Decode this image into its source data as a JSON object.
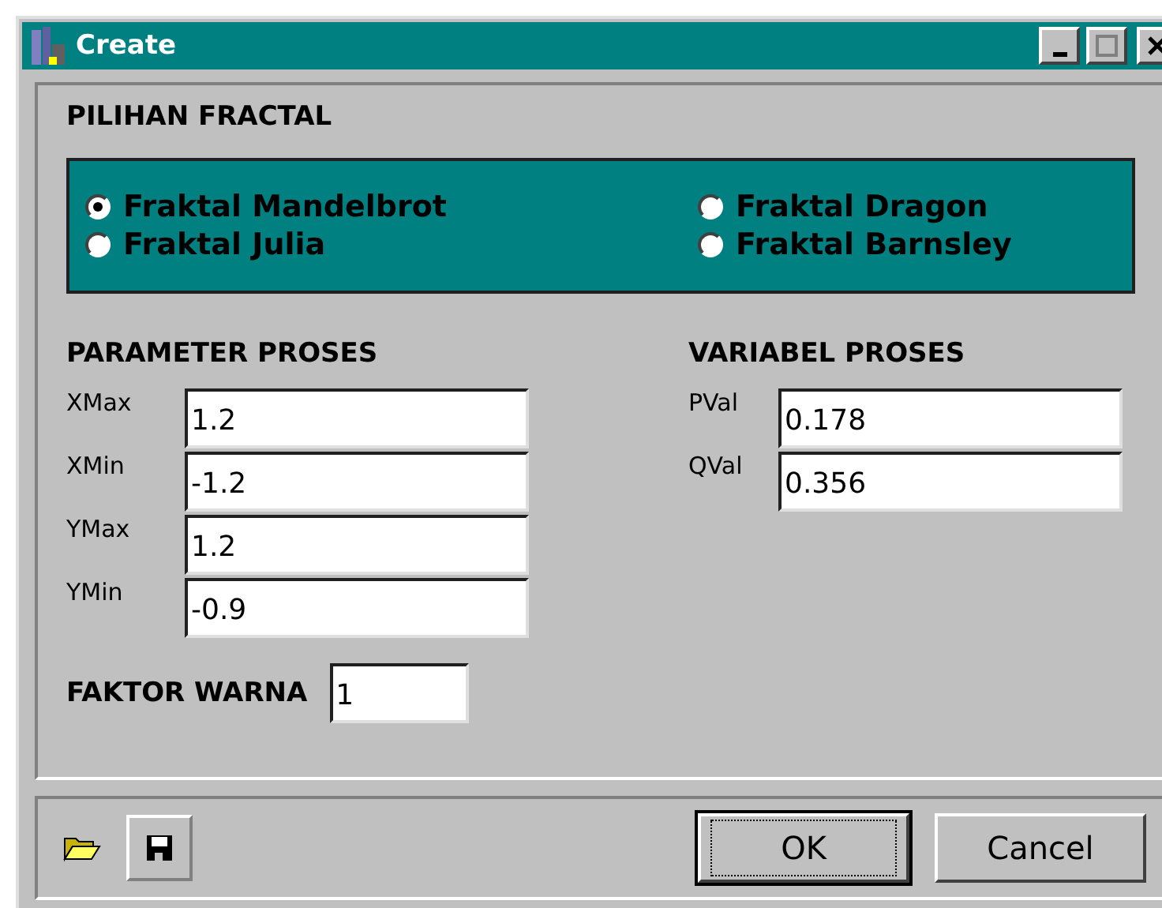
{
  "window": {
    "title": "Create"
  },
  "title_buttons": [
    {
      "kind": "minimize",
      "disabled": false
    },
    {
      "kind": "maximize",
      "disabled": true
    },
    {
      "kind": "close",
      "disabled": false
    }
  ],
  "fractal_group": {
    "heading": "PILIHAN FRACTAL",
    "options": [
      {
        "label": "Fraktal Mandelbrot",
        "selected": true
      },
      {
        "label": "Fraktal Julia",
        "selected": false
      },
      {
        "label": "Fraktal Dragon",
        "selected": false
      },
      {
        "label": "Fraktal Barnsley",
        "selected": false
      }
    ]
  },
  "parameters": {
    "heading": "PARAMETER PROSES",
    "fields": [
      {
        "label": "XMax",
        "value": "1.2"
      },
      {
        "label": "XMin",
        "value": "-1.2"
      },
      {
        "label": "YMax",
        "value": "1.2"
      },
      {
        "label": "YMin",
        "value": "-0.9"
      }
    ]
  },
  "variables": {
    "heading": "VARIABEL PROSES",
    "fields": [
      {
        "label": "PVal",
        "value": "0.178"
      },
      {
        "label": "QVal",
        "value": "0.356"
      }
    ]
  },
  "color_factor": {
    "label": "FAKTOR WARNA",
    "value": "1"
  },
  "toolbar": [
    {
      "kind": "open"
    },
    {
      "kind": "save"
    }
  ],
  "buttons": [
    {
      "label": "OK",
      "default": true
    },
    {
      "label": "Cancel",
      "default": false
    }
  ]
}
